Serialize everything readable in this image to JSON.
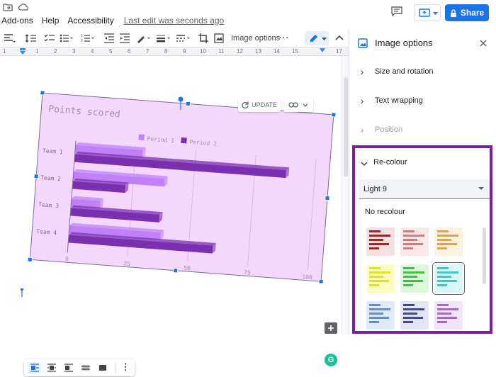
{
  "menu": {
    "items": [
      "Add-ons",
      "Help",
      "Accessibility"
    ],
    "last_edit": "Last edit was seconds ago"
  },
  "header": {
    "share_label": "Share",
    "accent_color": "#1a73e8"
  },
  "toolbar": {
    "image_options_label": "Image options"
  },
  "ruler": {
    "numbers": [
      "1",
      "1",
      "2",
      "3",
      "4",
      "5",
      "6",
      "7",
      "8",
      "9",
      "10",
      "11",
      "12",
      "13",
      "14",
      "15",
      "16",
      "17"
    ]
  },
  "panel": {
    "title": "Image options",
    "sections": [
      {
        "label": "Size and rotation",
        "state": "collapsed"
      },
      {
        "label": "Text wrapping",
        "state": "collapsed"
      },
      {
        "label": "Position",
        "state": "disabled"
      },
      {
        "label": "Re-colour",
        "state": "expanded"
      }
    ],
    "recolour_selected": "Light 9",
    "no_recolour_label": "No recolour",
    "highlight_color": "#7b1fa2",
    "swatches": [
      {
        "name": "Dark 1",
        "color": "#b71c1c",
        "bg": "#f8e0e0"
      },
      {
        "name": "Light 2",
        "color": "#e57373",
        "bg": "#fbe9e9"
      },
      {
        "name": "Light 3",
        "color": "#f0a030",
        "bg": "#fdf2e0"
      },
      {
        "name": "Light 4",
        "color": "#e6e600",
        "bg": "#fcfcc0"
      },
      {
        "name": "Light 5",
        "color": "#33cc33",
        "bg": "#dcf8dc"
      },
      {
        "name": "Light 6",
        "color": "#2ccfcf",
        "bg": "#d8f8f8"
      },
      {
        "name": "Light 7",
        "color": "#5b8fd8",
        "bg": "#e0ebfa"
      },
      {
        "name": "Light 8",
        "color": "#3949ab",
        "bg": "#e4e6f6"
      },
      {
        "name": "Light 9",
        "color": "#b060d8",
        "bg": "#f2e4fa"
      }
    ]
  },
  "chart_overlay": {
    "update_label": "UPDATE"
  },
  "grammarly_label": "G",
  "chart_data": {
    "type": "bar",
    "orientation": "horizontal",
    "title": "Points scored",
    "categories": [
      "Team 1",
      "Team 2",
      "Team 3",
      "Team 4"
    ],
    "series": [
      {
        "name": "Period 1",
        "values": [
          28,
          38,
          12,
          38
        ],
        "color": "#c080f8"
      },
      {
        "name": "Period 2",
        "values": [
          88,
          22,
          37,
          60
        ],
        "color": "#7a2fb0"
      }
    ],
    "xticks": [
      "0",
      "25",
      "50",
      "75",
      "100"
    ],
    "xlim": [
      0,
      100
    ],
    "legend": "top",
    "background": "#f4d8fc"
  }
}
